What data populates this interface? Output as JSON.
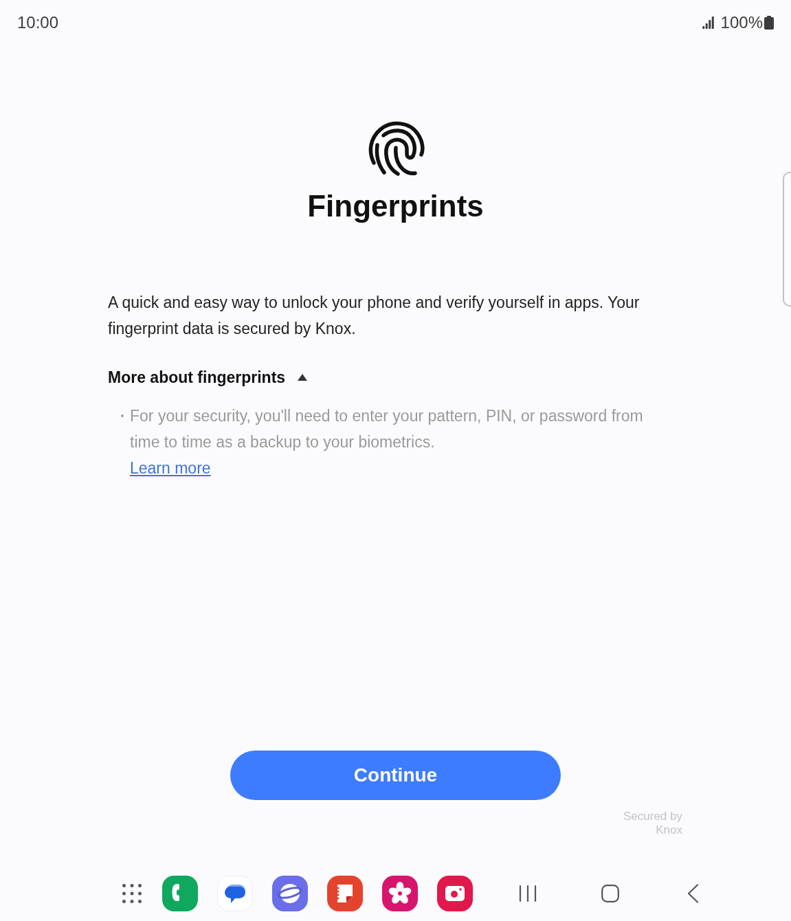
{
  "status_bar": {
    "time": "10:00",
    "battery_text": "100%"
  },
  "title": "Fingerprints",
  "description": "A quick and easy way to unlock your phone and verify yourself in apps. Your fingerprint data is secured by Knox.",
  "more_section": {
    "title": "More about fingerprints",
    "expanded": true,
    "bullets": [
      "For your security, you'll need to enter your pattern, PIN, or password from time to time as a backup to your biometrics."
    ],
    "link": "Learn more"
  },
  "continue_button": {
    "label": "Continue"
  },
  "footer_note": "Secured by Knox"
}
